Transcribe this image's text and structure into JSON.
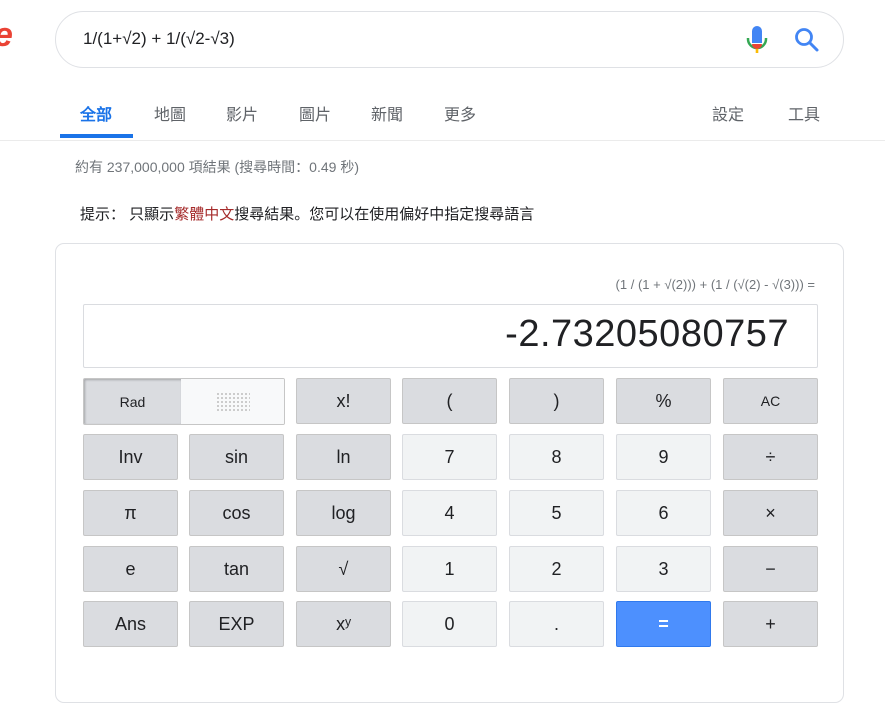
{
  "search": {
    "query": "1/(1+√2) + 1/(√2-√3)"
  },
  "tabs": [
    {
      "label": "全部"
    },
    {
      "label": "地圖"
    },
    {
      "label": "影片"
    },
    {
      "label": "圖片"
    },
    {
      "label": "新聞"
    },
    {
      "label": "更多"
    },
    {
      "label": "設定"
    },
    {
      "label": "工具"
    }
  ],
  "results_stats": "約有 237,000,000 項結果 (搜尋時間：0.49 秒)",
  "hint": {
    "prefix": "提示：",
    "middle_before": " 只顯示",
    "language": "繁體中文",
    "suffix": "搜尋結果。您可以在使用偏好中指定搜尋語言"
  },
  "calculator": {
    "expression": "(1 / (1 + √(2))) + (1 / (√(2) - √(3))) =",
    "display": "-2.73205080757",
    "mode_rad": "Rad",
    "keys": {
      "fact": "x!",
      "lparen": "(",
      "rparen": ")",
      "percent": "%",
      "ac": "AC",
      "inv": "Inv",
      "sin": "sin",
      "ln": "ln",
      "seven": "7",
      "eight": "8",
      "nine": "9",
      "divide": "÷",
      "pi": "π",
      "cos": "cos",
      "log": "log",
      "four": "4",
      "five": "5",
      "six": "6",
      "multiply": "×",
      "e": "e",
      "tan": "tan",
      "sqrt": "√",
      "one": "1",
      "two": "2",
      "three": "3",
      "minus": "−",
      "ans": "Ans",
      "exp": "EXP",
      "pow": "xʸ",
      "zero": "0",
      "dot": ".",
      "equals": "=",
      "plus": "+"
    }
  },
  "colors": {
    "accent": "#1a73e8",
    "equals_key": "#4d90fe",
    "hint_language": "#a52a2a"
  }
}
